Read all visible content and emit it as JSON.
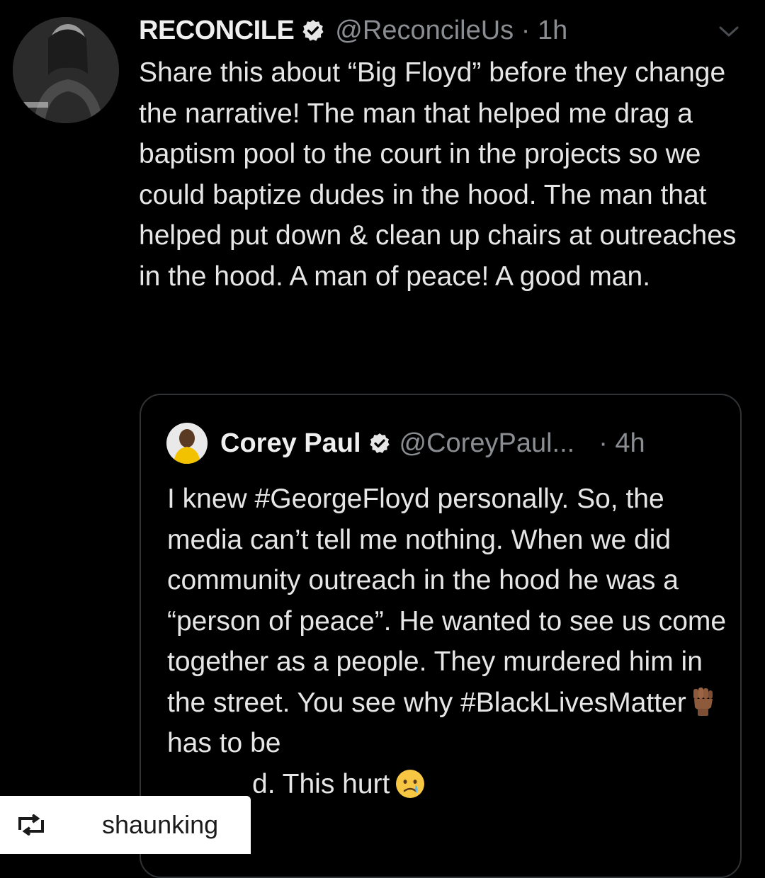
{
  "tweet": {
    "author_name": "RECONCILE",
    "handle_time": "@ReconcileUs · 1h",
    "text": "Share this about “Big Floyd” before they change the narrative! The man that helped me drag a baptism pool to the court in the projects so we could baptize dudes in the hood. The man that helped put down & clean up chairs at outreaches in the hood. A man of peace! A good man."
  },
  "quoted_tweet": {
    "author_name": "Corey Paul",
    "handle": "@CoreyPaul...",
    "time": "· 4h",
    "text_main": "I knew #GeorgeFloyd personally. So, the media can’t tell me nothing. When we did community outreach in the hood he was a “person of peace”. He wanted to see us come together as a people. They murdered him in the street. You see why #BlackLivesMatter",
    "text_after_emoji": " has to be",
    "text_tail": "d. This hurt"
  },
  "repost_badge": {
    "username": "shaunking"
  },
  "icons": {
    "verified": "verified-badge-icon",
    "more": "chevron-down-icon",
    "repost": "repost-icon",
    "raised_fist": "raised-fist-emoji",
    "crying": "crying-face-emoji"
  },
  "colors": {
    "background": "#000000",
    "text": "#e6e6e6",
    "muted": "#8a8d91",
    "border": "#2f3336",
    "badge_bg": "#ffffff"
  }
}
